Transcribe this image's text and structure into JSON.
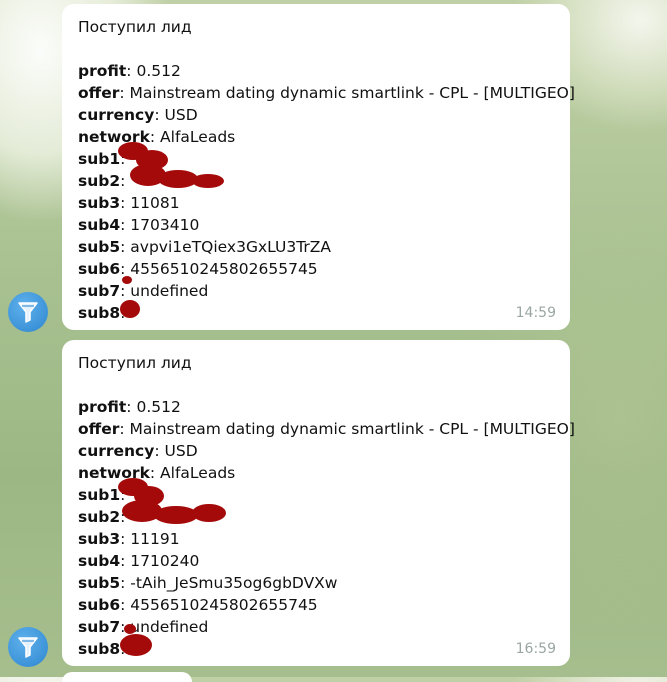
{
  "messages": [
    {
      "title": "Поступил лид",
      "fields": [
        {
          "key": "profit",
          "value": " 0.512"
        },
        {
          "key": "offer",
          "value": " Mainstream dating dynamic smartlink - CPL - [MULTIGEO]"
        },
        {
          "key": "currency",
          "value": " USD"
        },
        {
          "key": "network",
          "value": " AlfaLeads"
        },
        {
          "key": "sub1",
          "value": ""
        },
        {
          "key": "sub2",
          "value": ""
        },
        {
          "key": "sub3",
          "value": " 11081"
        },
        {
          "key": "sub4",
          "value": " 1703410"
        },
        {
          "key": "sub5",
          "value": " avpvi1eTQiex3GxLU3TrZA"
        },
        {
          "key": "sub6",
          "value": " 4556510245802655745"
        },
        {
          "key": "sub7",
          "value": " undefined"
        },
        {
          "key": "sub8",
          "value": ""
        }
      ],
      "time": "14:59"
    },
    {
      "title": "Поступил лид",
      "fields": [
        {
          "key": "profit",
          "value": " 0.512"
        },
        {
          "key": "offer",
          "value": " Mainstream dating dynamic smartlink - CPL - [MULTIGEO]"
        },
        {
          "key": "currency",
          "value": " USD"
        },
        {
          "key": "network",
          "value": " AlfaLeads"
        },
        {
          "key": "sub1",
          "value": ""
        },
        {
          "key": "sub2",
          "value": ""
        },
        {
          "key": "sub3",
          "value": " 11191"
        },
        {
          "key": "sub4",
          "value": " 1710240"
        },
        {
          "key": "sub5",
          "value": " -tAih_JeSmu35og6gbDVXw"
        },
        {
          "key": "sub6",
          "value": " 4556510245802655745"
        },
        {
          "key": "sub7",
          "value": " undefined"
        },
        {
          "key": "sub8",
          "value": ""
        }
      ],
      "time": "16:59"
    }
  ],
  "colors": {
    "bubble": "#ffffff",
    "redaction": "#a50a0a",
    "avatar": "#3c93d8",
    "time": "#9aa7a0"
  },
  "icons": {
    "avatar": "funnel-icon"
  }
}
